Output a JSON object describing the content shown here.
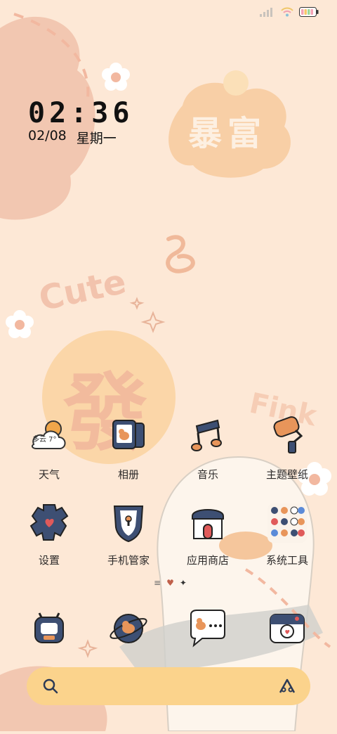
{
  "status": {
    "battery_icon": "battery-icon",
    "wifi_icon": "wifi-icon",
    "signal_icon": "signal-icon"
  },
  "clock": {
    "time": "02:36",
    "date": "02/08",
    "weekday": "星期一"
  },
  "wallpaper": {
    "cloud_text": "暴富",
    "center_text": "發",
    "cute_text": "Cute",
    "fink_text": "Fink"
  },
  "apps_row1": [
    {
      "label": "天气",
      "icon": "weather-icon",
      "badge": "多云 7°"
    },
    {
      "label": "相册",
      "icon": "gallery-icon"
    },
    {
      "label": "音乐",
      "icon": "music-icon"
    },
    {
      "label": "主题壁纸",
      "icon": "theme-wallpaper-icon"
    }
  ],
  "apps_row2": [
    {
      "label": "设置",
      "icon": "settings-gear-icon"
    },
    {
      "label": "手机管家",
      "icon": "phone-manager-shield-icon"
    },
    {
      "label": "应用商店",
      "icon": "app-store-house-icon"
    },
    {
      "label": "系统工具",
      "icon": "system-tools-folder-icon"
    }
  ],
  "dock": [
    {
      "icon": "phone-icon"
    },
    {
      "icon": "browser-icon"
    },
    {
      "icon": "messages-icon"
    },
    {
      "icon": "camera-icon"
    }
  ],
  "colors": {
    "background": "#fde8d6",
    "search_bar": "#fbd38c",
    "navy": "#3d4f73",
    "orange": "#e8955a"
  }
}
